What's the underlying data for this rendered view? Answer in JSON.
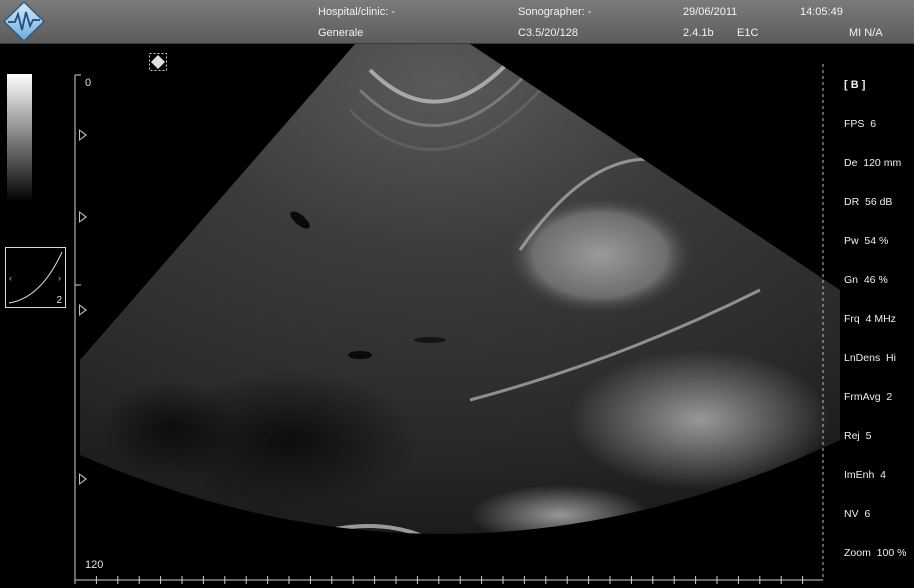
{
  "header": {
    "hospital_label": "Hospital/clinic: -",
    "hospital_value": "Generale",
    "sonographer_label": "Sonographer: -",
    "probe": "C3.5/20/128",
    "date": "29/06/2011",
    "version": "2.4.1b",
    "preset": "E1C",
    "time": "14:05:49",
    "mi": "MI N/A"
  },
  "depth_scale": {
    "top": "0",
    "bottom": "120"
  },
  "gain_curve": {
    "value": "2"
  },
  "params": {
    "mode": "[ B ]",
    "items": [
      "FPS  6",
      "De  120 mm",
      "DR  56 dB",
      "Pw  54 %",
      "Gn  46 %",
      "Frq  4 MHz",
      "LnDens  Hi",
      "FrmAvg  2",
      "Rej  5",
      "ImEnh  4",
      "NV  6",
      "Zoom  100 %"
    ]
  },
  "colors": {
    "header_bg": "#6a6a6a",
    "image_bg": "#000000",
    "text": "#f0f0f0"
  },
  "icons": {
    "logo": "diamond-wave-logo-icon",
    "freeze": "diamond-freeze-icon"
  }
}
